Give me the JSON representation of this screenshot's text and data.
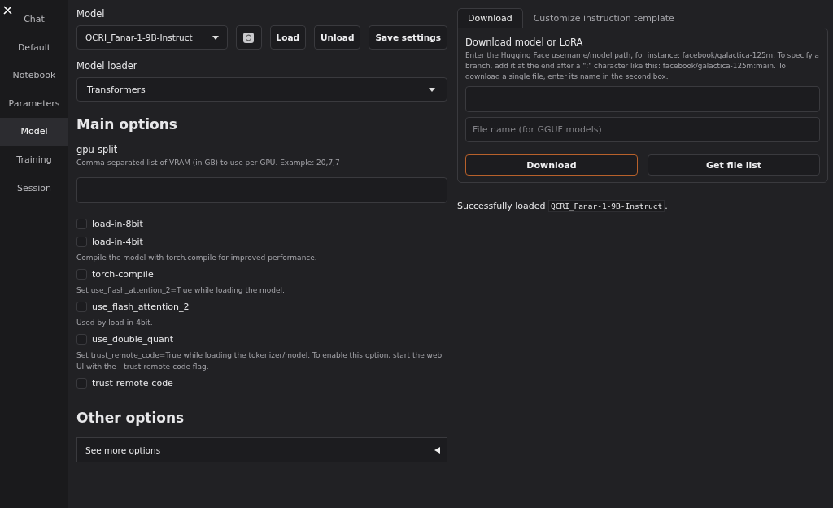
{
  "sidebar": {
    "items": [
      {
        "label": "Chat",
        "selected": false
      },
      {
        "label": "Default",
        "selected": false
      },
      {
        "label": "Notebook",
        "selected": false
      },
      {
        "label": "Parameters",
        "selected": false
      },
      {
        "label": "Model",
        "selected": true
      },
      {
        "label": "Training",
        "selected": false
      },
      {
        "label": "Session",
        "selected": false
      }
    ]
  },
  "model": {
    "label": "Model",
    "value": "QCRI_Fanar-1-9B-Instruct",
    "buttons": [
      "Load",
      "Unload",
      "Save settings"
    ]
  },
  "model_loader": {
    "label": "Model loader",
    "value": "Transformers"
  },
  "main_options": {
    "title": "Main options",
    "gpu_split": {
      "label": "gpu-split",
      "info": "Comma-separated list of VRAM (in GB) to use per GPU. Example: 20,7,7"
    },
    "checkboxes": [
      {
        "label": "load-in-8bit",
        "checked": false
      },
      {
        "label": "load-in-4bit",
        "checked": false
      },
      {
        "info": "Compile the model with torch.compile for improved performance.",
        "label": "torch-compile",
        "checked": false
      },
      {
        "info": "Set use_flash_attention_2=True while loading the model.",
        "label": "use_flash_attention_2",
        "checked": false
      },
      {
        "info": "Used by load-in-4bit.",
        "label": "use_double_quant",
        "checked": false
      },
      {
        "info": "Set trust_remote_code=True while loading the tokenizer/model. To enable this option, start the web UI with the --trust-remote-code flag.",
        "label": "trust-remote-code",
        "checked": false
      }
    ]
  },
  "other_options": {
    "title": "Other options",
    "accordion": {
      "label": "See more options",
      "expanded": false
    }
  },
  "tabs": [
    {
      "label": "Download",
      "selected": true
    },
    {
      "label": "Customize instruction template",
      "selected": false
    }
  ],
  "download": {
    "title": "Download model or LoRA",
    "info": "Enter the Hugging Face username/model path, for instance: facebook/galactica-125m. To specify a branch, add it at the end after a \":\" character like this: facebook/galactica-125m:main. To download a single file, enter its name in the second box.",
    "file_placeholder": "File name (for GGUF models)",
    "buttons": [
      "Download",
      "Get file list"
    ]
  },
  "status": {
    "text": "Successfully loaded",
    "code": "QCRI_Fanar-1-9B-Instruct",
    "suffix": "."
  }
}
